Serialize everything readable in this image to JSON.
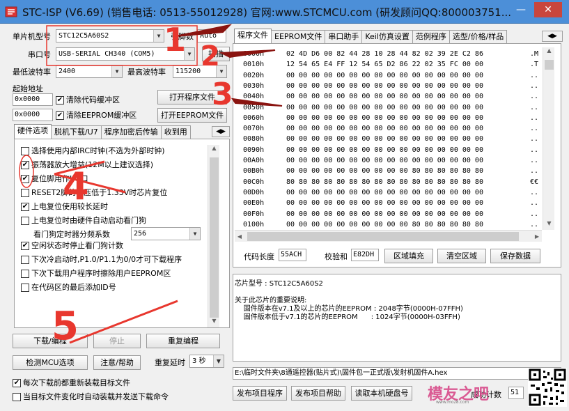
{
  "window": {
    "title": "STC-ISP (V6.69) (销售电话: 0513-55012928) 官网:www.STCMCU.com (研发顾问QQ:800003751..."
  },
  "left": {
    "mcu_label": "单片机型号",
    "mcu_value": "STC12C5A60S2",
    "pins_label": "引脚数",
    "pins_value": "Auto",
    "port_label": "串口号",
    "port_value": "USB-SERIAL CH340 (COM5)",
    "scan_button": "扫描",
    "min_baud_label": "最低波特率",
    "min_baud_value": "2400",
    "max_baud_label": "最高波特率",
    "max_baud_value": "115200",
    "start_addr_label": "起始地址",
    "addr1": "0x0000",
    "addr2": "0x0000",
    "clear_code_label": "清除代码缓冲区",
    "clear_eeprom_label": "清除EEPROM缓冲区",
    "open_program_button": "打开程序文件",
    "open_eeprom_button": "打开EEPROM文件",
    "tabs": [
      "硬件选项",
      "脱机下载/U7",
      "程序加密后传输",
      "收到用"
    ],
    "options": [
      {
        "label": "选择使用内部IRC时钟(不选为外部时钟)",
        "checked": false
      },
      {
        "label": "振荡器放大增益(12M以上建议选择)",
        "checked": true
      },
      {
        "label": "复位脚用作I/O口",
        "checked": true
      },
      {
        "label": "RESET2脚的电压低于1.33V时芯片复位",
        "checked": false
      },
      {
        "label": "上电复位使用较长延时",
        "checked": true
      },
      {
        "label": "上电复位时由硬件自动启动看门狗",
        "checked": false
      },
      {
        "label": "空闲状态时停止看门狗计数",
        "checked": true
      },
      {
        "label": "下次冷启动时,P1.0/P1.1为0/0才可下载程序",
        "checked": false
      },
      {
        "label": "下次下载用户程序时擦除用户EEPROM区",
        "checked": false
      },
      {
        "label": "在代码区的最后添加ID号",
        "checked": false
      }
    ],
    "wdt_label": "看门狗定时器分频系数",
    "wdt_value": "256",
    "download_button": "下载/编程",
    "stop_button": "停止",
    "reprogram_button": "重复编程",
    "detect_button": "检测MCU选项",
    "help_button": "注意/帮助",
    "delay_label": "重复延时",
    "delay_value": "3 秒",
    "reload_label": "每次下载前都重新装载目标文件",
    "auto_label": "当目标文件变化时自动装载并发送下载命令",
    "reload_checked": true,
    "auto_checked": false
  },
  "right": {
    "tabs": [
      "程序文件",
      "EEPROM文件",
      "串口助手",
      "Keil仿真设置",
      "范例程序",
      "选型/价格/样品"
    ],
    "hex_rows": [
      {
        "addr": "0000h",
        "bytes": "02 4D D6 00 82 44 28 10 28 44 82 02 39 2E C2 86",
        "ascii": ".M"
      },
      {
        "addr": "0010h",
        "bytes": "12 54 65 E4 FF 12 54 65 D2 86 22 02 35 FC 00 00",
        "ascii": ".T"
      },
      {
        "addr": "0020h",
        "bytes": "00 00 00 00 00 00 00 00 00 00 00 00 00 00 00 00",
        "ascii": ".."
      },
      {
        "addr": "0030h",
        "bytes": "00 00 00 00 00 00 00 00 00 00 00 00 00 00 00 00",
        "ascii": ".."
      },
      {
        "addr": "0040h",
        "bytes": "00 00 00 00 00 00 00 00 00 00 00 00 00 00 00 00",
        "ascii": ".."
      },
      {
        "addr": "0050h",
        "bytes": "00 00 00 00 00 00 00 00 00 00 00 00 00 00 00 00",
        "ascii": ".."
      },
      {
        "addr": "0060h",
        "bytes": "00 00 00 00 00 00 00 00 00 00 00 00 00 00 00 00",
        "ascii": ".."
      },
      {
        "addr": "0070h",
        "bytes": "00 00 00 00 00 00 00 00 00 00 00 00 00 00 00 00",
        "ascii": ".."
      },
      {
        "addr": "0080h",
        "bytes": "00 00 00 00 00 00 00 00 00 00 00 00 00 00 00 00",
        "ascii": ".."
      },
      {
        "addr": "0090h",
        "bytes": "00 00 00 00 00 00 00 00 00 00 00 00 00 00 00 00",
        "ascii": ".."
      },
      {
        "addr": "00A0h",
        "bytes": "00 00 00 00 00 00 00 00 00 00 00 00 00 00 00 00",
        "ascii": ".."
      },
      {
        "addr": "00B0h",
        "bytes": "00 00 00 00 00 00 00 00 00 00 80 80 80 80 80 80",
        "ascii": ".."
      },
      {
        "addr": "00C0h",
        "bytes": "80 80 80 80 80 80 80 80 80 80 80 80 80 80 80 80",
        "ascii": "€€"
      },
      {
        "addr": "00D0h",
        "bytes": "00 00 00 00 00 00 00 00 00 00 00 00 00 00 00 00",
        "ascii": ".."
      },
      {
        "addr": "00E0h",
        "bytes": "00 00 00 00 00 00 00 00 00 00 00 00 00 00 00 00",
        "ascii": ".."
      },
      {
        "addr": "00F0h",
        "bytes": "00 00 00 00 00 00 00 00 00 00 00 00 00 00 00 00",
        "ascii": ".."
      },
      {
        "addr": "0100h",
        "bytes": "00 00 00 00 00 00 00 00 00 00 80 80 80 80 80 80",
        "ascii": ".."
      }
    ],
    "code_len_label": "代码长度",
    "code_len_value": "55ACH",
    "checksum_label": "校验和",
    "checksum_value": "E82DH",
    "fill_button": "区域填充",
    "clear_button": "清空区域",
    "save_button": "保存数据",
    "info_line1": "芯片型号 : STC12C5A60S2",
    "info_line2": "关于此芯片的重要说明:",
    "info_line3": "    固件版本在v7.1及以上的芯片的EEPROM : 2048字节(0000H-07FFH)",
    "info_line4": "    固件版本低于v7.1的芯片的EEPROM      : 1024字节(0000H-03FFH)",
    "path": "E:\\临时文件夹\\8通遥控器(贴片式)\\固件包一正式版\\发射机固件A.hex",
    "publish_button": "发布项目程序",
    "publish_help_button": "发布项目帮助",
    "read_disk_button": "读取本机硬盘号",
    "success_label": "成功计数",
    "count_value": "51"
  },
  "annotations": [
    "1",
    "2",
    "3",
    "4",
    "5"
  ],
  "watermark": {
    "text": "模友之吧",
    "url": "www.moz8.com"
  },
  "colors": {
    "annotation": "#e8372e",
    "titlebar": "#4c8fd8",
    "close": "#c9463d"
  }
}
